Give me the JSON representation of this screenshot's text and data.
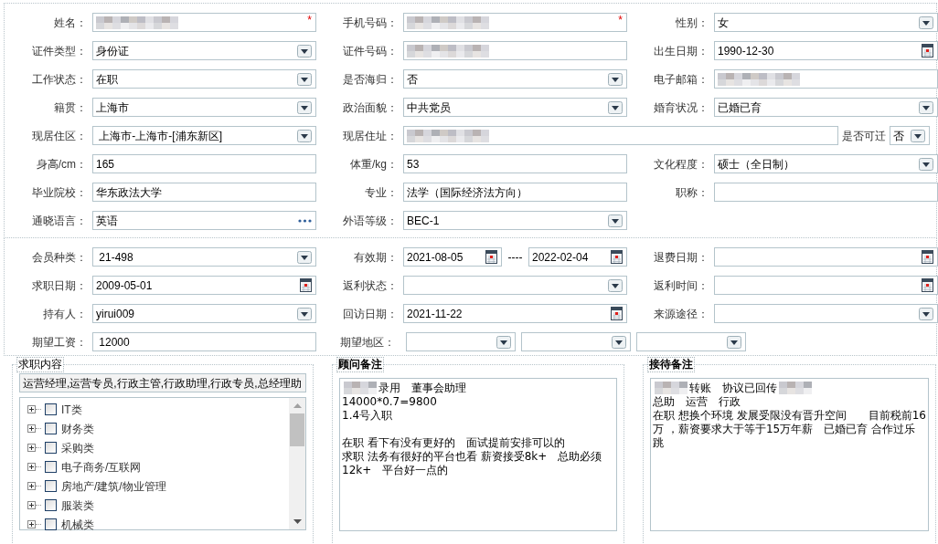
{
  "basic_info": {
    "rows": [
      {
        "cells": [
          {
            "kind": "field",
            "label": "姓名：",
            "field": {
              "kind": "text",
              "redacted": true,
              "required_mark": "*"
            }
          },
          {
            "kind": "field",
            "label": "手机号码：",
            "field": {
              "kind": "text",
              "redacted": true,
              "required_mark": "*"
            }
          },
          {
            "kind": "field",
            "label": "性别：",
            "field": {
              "kind": "select",
              "value": "女"
            }
          }
        ]
      },
      {
        "cells": [
          {
            "kind": "field",
            "label": "证件类型：",
            "field": {
              "kind": "select",
              "value": "身份证"
            }
          },
          {
            "kind": "field",
            "label": "证件号码：",
            "field": {
              "kind": "text",
              "redacted": true
            }
          },
          {
            "kind": "field",
            "label": "出生日期：",
            "field": {
              "kind": "date",
              "value": "1990-12-30"
            }
          }
        ]
      },
      {
        "cells": [
          {
            "kind": "field",
            "label": "工作状态：",
            "field": {
              "kind": "select",
              "value": "在职"
            }
          },
          {
            "kind": "field",
            "label": "是否海归：",
            "field": {
              "kind": "select",
              "value": "否"
            }
          },
          {
            "kind": "field",
            "label": "电子邮箱：",
            "field": {
              "kind": "text",
              "redacted": true
            }
          }
        ]
      },
      {
        "cells": [
          {
            "kind": "field",
            "label": "籍贯：",
            "field": {
              "kind": "select",
              "value": "上海市"
            }
          },
          {
            "kind": "field",
            "label": "政治面貌：",
            "field": {
              "kind": "select",
              "value": "中共党员"
            }
          },
          {
            "kind": "field",
            "label": "婚育状况：",
            "field": {
              "kind": "select",
              "value": "已婚已育"
            }
          }
        ]
      },
      {
        "cells": [
          {
            "kind": "field",
            "label": "现居住区：",
            "field": {
              "kind": "select",
              "value": " 上海市-上海市-[浦东新区]"
            }
          },
          {
            "kind": "wide",
            "label": "现居住址：",
            "field": {
              "kind": "text",
              "redacted": true
            }
          },
          {
            "kind": "inline",
            "label": "是否可迁",
            "field": {
              "kind": "select",
              "value": "否"
            }
          }
        ]
      },
      {
        "cells": [
          {
            "kind": "field",
            "label": "身高/cm：",
            "field": {
              "kind": "text",
              "value": "165"
            }
          },
          {
            "kind": "field",
            "label": "体重/kg：",
            "field": {
              "kind": "text",
              "value": "53"
            }
          },
          {
            "kind": "field",
            "label": "文化程度：",
            "field": {
              "kind": "select",
              "value": "硕士（全日制）"
            }
          }
        ]
      },
      {
        "cells": [
          {
            "kind": "field",
            "label": "毕业院校：",
            "field": {
              "kind": "text",
              "value": "华东政法大学"
            }
          },
          {
            "kind": "field",
            "label": "专业：",
            "field": {
              "kind": "text",
              "value": "法学（国际经济法方向）"
            }
          },
          {
            "kind": "field",
            "label": "职称：",
            "field": {
              "kind": "text"
            }
          }
        ]
      },
      {
        "cells": [
          {
            "kind": "field",
            "label": "通晓语言：",
            "field": {
              "kind": "lookup",
              "value": "英语"
            }
          },
          {
            "kind": "field",
            "label": "外语等级：",
            "field": {
              "kind": "select",
              "value": "BEC-1"
            }
          }
        ]
      }
    ]
  },
  "membership": {
    "rows": [
      {
        "cells": [
          {
            "kind": "field",
            "label": "会员种类：",
            "field": {
              "kind": "select",
              "value": " 21-498"
            }
          },
          {
            "kind": "range",
            "label": "有效期：",
            "separator": "----",
            "fields": [
              {
                "kind": "date",
                "value": "2021-08-05"
              },
              {
                "kind": "date",
                "value": "2022-02-04"
              }
            ]
          },
          {
            "kind": "field",
            "label": "退费日期：",
            "field": {
              "kind": "date"
            }
          }
        ]
      },
      {
        "cells": [
          {
            "kind": "field",
            "label": "求职日期：",
            "field": {
              "kind": "date",
              "value": "2009-05-01"
            }
          },
          {
            "kind": "field",
            "label": "返利状态：",
            "field": {
              "kind": "select"
            }
          },
          {
            "kind": "field",
            "label": "返利时间：",
            "field": {
              "kind": "date"
            }
          }
        ]
      },
      {
        "cells": [
          {
            "kind": "field",
            "label": "持有人：",
            "field": {
              "kind": "select",
              "value": "yirui009"
            }
          },
          {
            "kind": "field",
            "label": "回访日期：",
            "field": {
              "kind": "date",
              "value": "2021-11-22"
            }
          },
          {
            "kind": "field",
            "label": "来源途径：",
            "field": {
              "kind": "select"
            }
          }
        ]
      },
      {
        "cells": [
          {
            "kind": "field",
            "label": "期望工资：",
            "field": {
              "kind": "text",
              "value": " 12000"
            }
          },
          {
            "kind": "multi",
            "label": "期望地区：",
            "fields": [
              {
                "kind": "select"
              },
              {
                "kind": "select"
              },
              {
                "kind": "select"
              }
            ]
          }
        ]
      }
    ]
  },
  "job_intent": {
    "legend": "求职内容",
    "summary": "运营经理,运营专员,行政主管,行政助理,行政专员,总经理助",
    "tree": [
      {
        "label": "IT类",
        "expanded": false,
        "checked": false
      },
      {
        "label": "财务类",
        "expanded": false,
        "checked": false
      },
      {
        "label": "采购类",
        "expanded": false,
        "checked": false
      },
      {
        "label": "电子商务/互联网",
        "expanded": false,
        "checked": false
      },
      {
        "label": "房地产/建筑/物业管理",
        "expanded": false,
        "checked": false
      },
      {
        "label": "服装类",
        "expanded": false,
        "checked": false
      },
      {
        "label": "机械类",
        "expanded": false,
        "checked": false
      }
    ]
  },
  "notes": [
    {
      "legend": "顾问备注",
      "paragraphs": [
        [
          {
            "parts": [
              {
                "kind": "redacted"
              },
              {
                "kind": "text",
                "text": "录用　董事会助理"
              }
            ]
          },
          {
            "parts": [
              {
                "kind": "text",
                "text": "14000*0.7=9800"
              }
            ]
          },
          {
            "parts": [
              {
                "kind": "text",
                "text": "1.4号入职"
              }
            ]
          }
        ],
        [
          {
            "parts": [
              {
                "kind": "text",
                "text": "在职 看下有没有更好的　面试提前安排可以的"
              }
            ]
          },
          {
            "parts": [
              {
                "kind": "text",
                "text": "求职 法务有很好的平台也看 薪资接受8k+　总助必须"
              }
            ]
          },
          {
            "parts": [
              {
                "kind": "text",
                "text": "12k+　平台好一点的"
              }
            ]
          }
        ]
      ]
    },
    {
      "legend": "接待备注",
      "paragraphs": [
        [
          {
            "parts": [
              {
                "kind": "redacted"
              },
              {
                "kind": "text",
                "text": "转账　协议已回传"
              },
              {
                "kind": "redacted"
              }
            ]
          },
          {
            "parts": [
              {
                "kind": "text",
                "text": "总助　运营　行政"
              }
            ]
          },
          {
            "parts": [
              {
                "kind": "text",
                "text": "在职 想换个环境 发展受限没有晋升空间　　目前税前16"
              }
            ]
          },
          {
            "parts": [
              {
                "kind": "text",
                "text": "万 ，薪资要求大于等于15万年薪　已婚已育 合作过乐"
              }
            ]
          },
          {
            "parts": [
              {
                "kind": "text",
                "text": "跳"
              }
            ]
          }
        ]
      ]
    }
  ]
}
